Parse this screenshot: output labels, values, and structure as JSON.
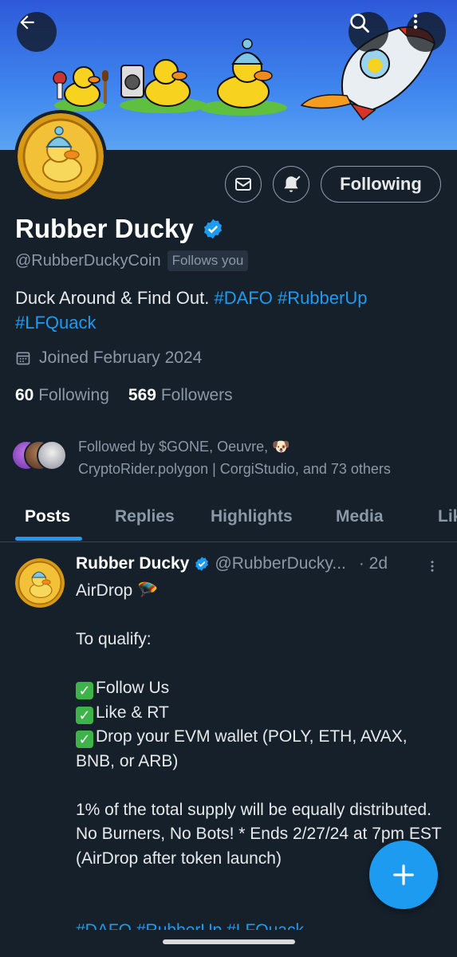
{
  "header": {
    "back_icon": "arrow-left-icon",
    "search_icon": "search-icon",
    "more_icon": "more-vertical-icon"
  },
  "profile": {
    "name": "Rubber Ducky",
    "verified": true,
    "handle": "@RubberDuckyCoin",
    "follows_you": "Follows you",
    "bio_text": "Duck Around & Find Out. ",
    "bio_tags": [
      "#DAFO",
      "#RubberUp",
      "#LFQuack"
    ],
    "joined": "Joined February 2024",
    "following_count": "60",
    "following_label": "Following",
    "followers_count": "569",
    "followers_label": "Followers",
    "followed_by_line1": "Followed by $GONE, Oeuvre, 🐶",
    "followed_by_line2": "CryptoRider.polygon | CorgiStudio, and 73 others",
    "following_button": "Following"
  },
  "tabs": [
    {
      "label": "Posts",
      "active": true
    },
    {
      "label": "Replies",
      "active": false
    },
    {
      "label": "Highlights",
      "active": false
    },
    {
      "label": "Media",
      "active": false
    },
    {
      "label": "Lik",
      "active": false
    }
  ],
  "post": {
    "name": "Rubber Ducky",
    "handle": "@RubberDucky...",
    "time": "· 2d",
    "line1": "AirDrop 🪂",
    "line2": "To qualify:",
    "check1": "Follow Us",
    "check2": "Like & RT",
    "check3": "Drop your EVM wallet (POLY, ETH, AVAX, BNB, or ARB)",
    "paragraph": "1% of the total supply will be equally distributed. No Burners, No Bots! * Ends 2/27/24 at 7pm EST (AirDrop after token launch)",
    "tags": "#DAFO #RubberUp #LFQuack"
  },
  "colors": {
    "background": "#15202b",
    "accent": "#1d9bf0",
    "muted": "#8b98a5",
    "banner": "#3f86ee"
  }
}
